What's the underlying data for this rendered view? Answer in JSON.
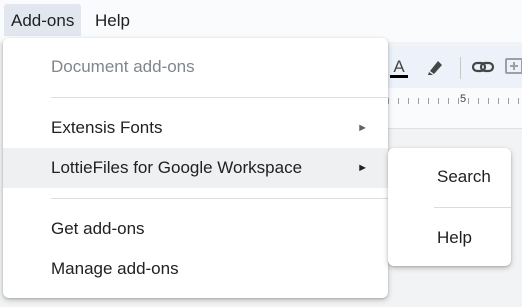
{
  "menubar": {
    "items": [
      {
        "label": "Add-ons"
      },
      {
        "label": "Help"
      }
    ]
  },
  "toolbar": {
    "icons": [
      "text-color-icon",
      "highlight-icon",
      "link-icon",
      "add-comment-icon"
    ],
    "ruler_number": "5"
  },
  "addons_menu": {
    "section_header": "Document add-ons",
    "items": [
      {
        "label": "Extensis Fonts",
        "submenu_arrow": "►"
      },
      {
        "label": "LottieFiles for Google Workspace",
        "submenu_arrow": "►"
      }
    ],
    "get_addons": "Get add-ons",
    "manage_addons": "Manage add-ons"
  },
  "submenu": {
    "items": [
      {
        "label": "Search"
      },
      {
        "label": "Help"
      }
    ]
  },
  "colors": {
    "highlight": "#eef0f2",
    "active_menubar": "#e1e6ef",
    "disabled_text": "#80868b"
  }
}
